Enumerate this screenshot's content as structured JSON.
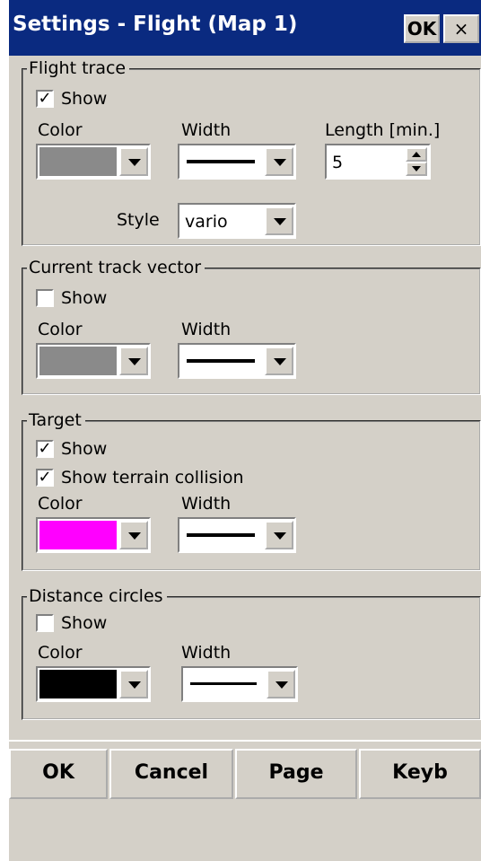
{
  "window": {
    "title": "Settings - Flight (Map 1)",
    "ok_label": "OK",
    "close_label": "×"
  },
  "flight_trace": {
    "legend": "Flight trace",
    "show_label": "Show",
    "show_checked": true,
    "show_mark": "✓",
    "color_label": "Color",
    "color_value": "#8a8a8a",
    "width_label": "Width",
    "length_label": "Length [min.]",
    "length_value": "5",
    "style_label": "Style",
    "style_value": "vario"
  },
  "current_track_vector": {
    "legend": "Current track vector",
    "show_label": "Show",
    "show_checked": false,
    "color_label": "Color",
    "color_value": "#8a8a8a",
    "width_label": "Width"
  },
  "target": {
    "legend": "Target",
    "show_label": "Show",
    "show_checked": true,
    "show_mark": "✓",
    "terrain_label": "Show terrain collision",
    "terrain_checked": true,
    "terrain_mark": "✓",
    "color_label": "Color",
    "color_value": "#ff00ff",
    "width_label": "Width"
  },
  "distance_circles": {
    "legend": "Distance circles",
    "show_label": "Show",
    "show_checked": false,
    "color_label": "Color",
    "color_value": "#000000",
    "width_label": "Width"
  },
  "bottom_bar": {
    "ok": "OK",
    "cancel": "Cancel",
    "page": "Page",
    "keyb": "Keyb"
  }
}
